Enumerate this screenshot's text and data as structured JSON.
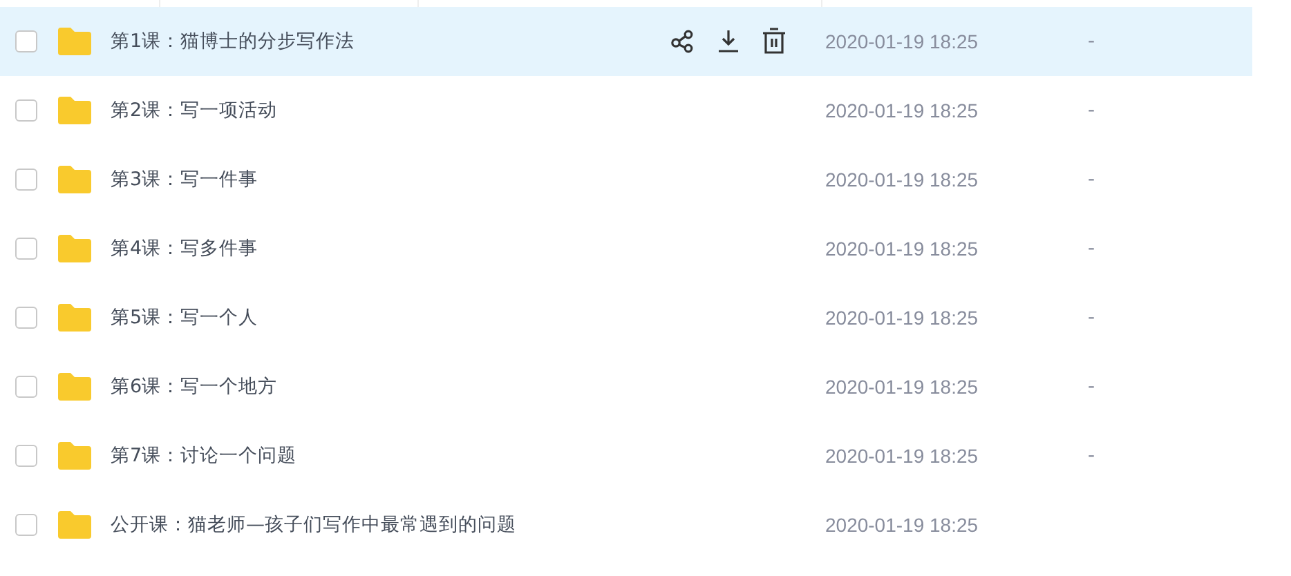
{
  "rows": [
    {
      "name": "第1课：猫博士的分步写作法",
      "date": "2020-01-19 18:25",
      "size": "-",
      "checked": false,
      "hovered": true
    },
    {
      "name": "第2课：写一项活动",
      "date": "2020-01-19 18:25",
      "size": "-",
      "checked": false,
      "hovered": false
    },
    {
      "name": "第3课：写一件事",
      "date": "2020-01-19 18:25",
      "size": "-",
      "checked": false,
      "hovered": false
    },
    {
      "name": "第4课：写多件事",
      "date": "2020-01-19 18:25",
      "size": "-",
      "checked": false,
      "hovered": false
    },
    {
      "name": "第5课：写一个人",
      "date": "2020-01-19 18:25",
      "size": "-",
      "checked": false,
      "hovered": false
    },
    {
      "name": "第6课：写一个地方",
      "date": "2020-01-19 18:25",
      "size": "-",
      "checked": false,
      "hovered": false
    },
    {
      "name": "第7课：讨论一个问题",
      "date": "2020-01-19 18:25",
      "size": "-",
      "checked": false,
      "hovered": false
    },
    {
      "name": "公开课：猫老师—孩子们写作中最常遇到的问题",
      "date": "2020-01-19 18:25",
      "checked": false,
      "hovered": false
    }
  ]
}
